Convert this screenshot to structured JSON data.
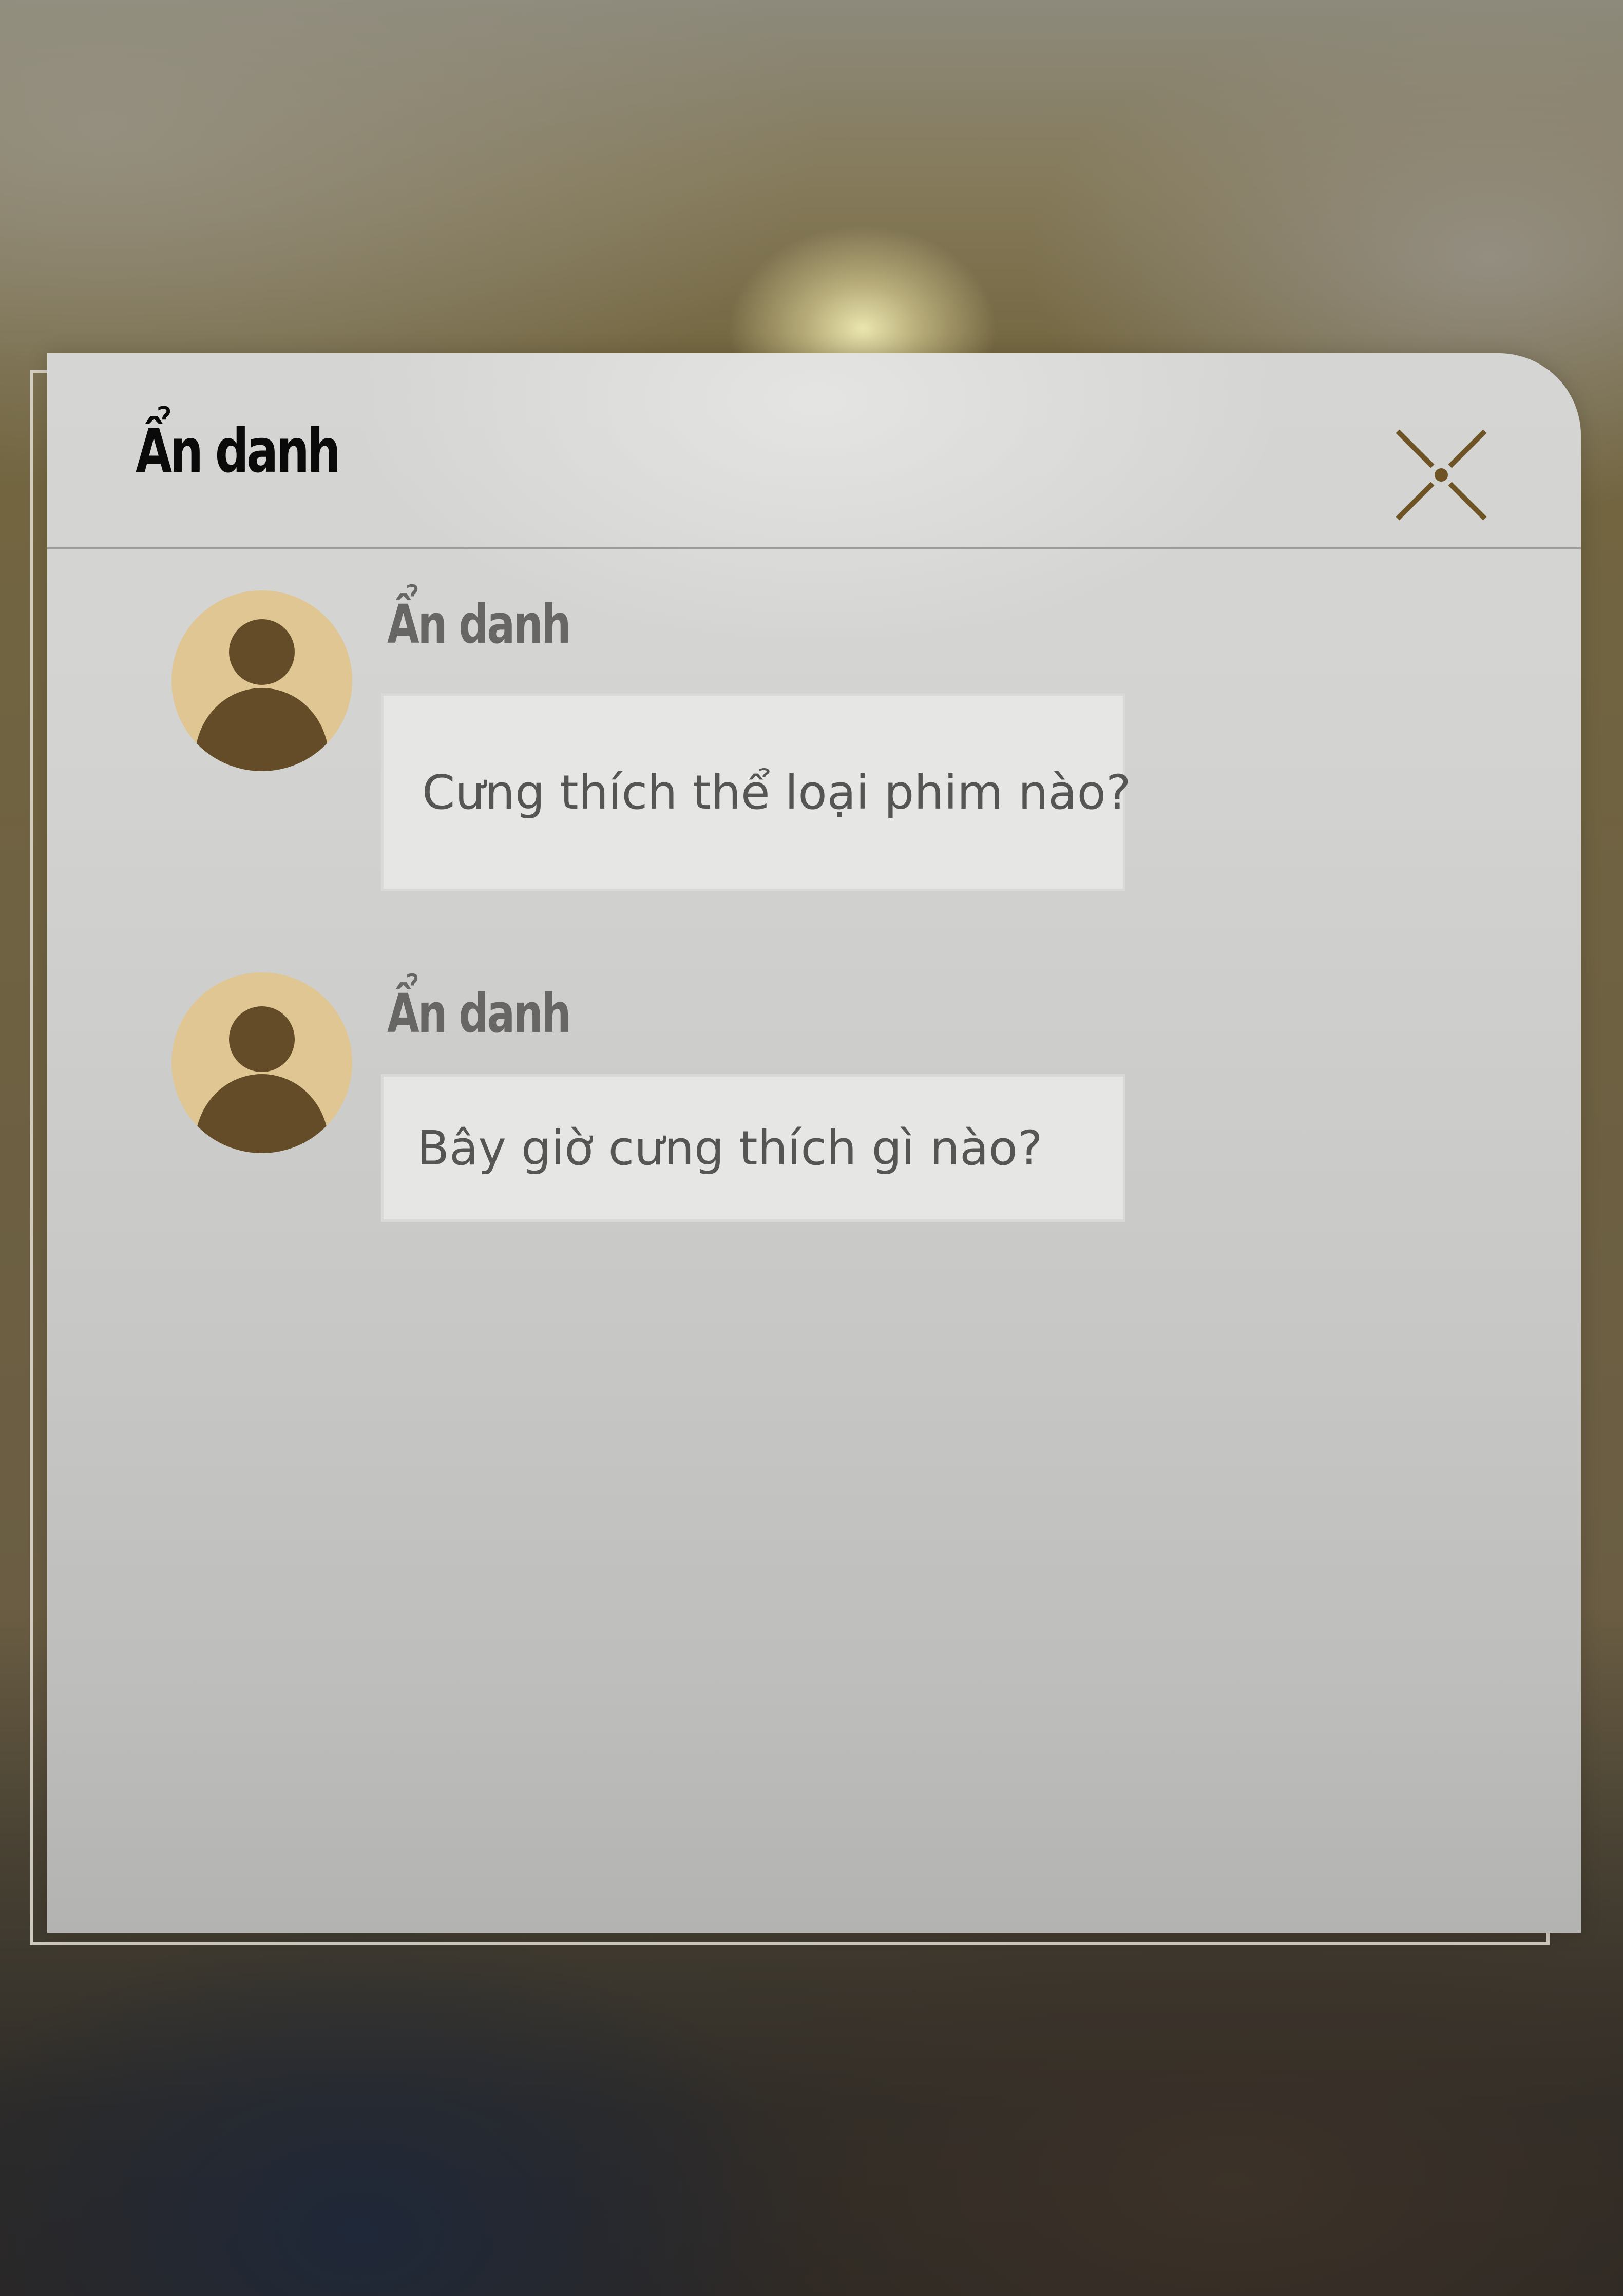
{
  "window": {
    "title": "Ẩn danh",
    "close_icon": "close-x-icon"
  },
  "messages": [
    {
      "sender": "Ẩn danh",
      "avatar_icon": "user-avatar-icon",
      "text": "Cưng thích thể loại phim nào?"
    },
    {
      "sender": "Ẩn danh",
      "avatar_icon": "user-avatar-icon",
      "text": "Bây giờ cưng thích gì nào?"
    }
  ],
  "colors": {
    "avatar_bg": "#dfc692",
    "avatar_fg": "#644c28",
    "close_icon": "#6e5424",
    "bubble_bg": "#e6e6e5",
    "title_text": "#0a0a0a",
    "sender_text": "#676664"
  }
}
